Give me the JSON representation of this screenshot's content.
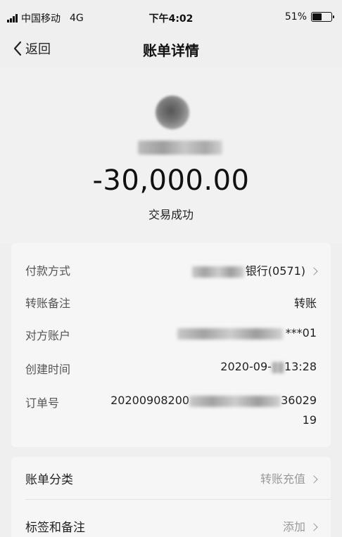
{
  "status_bar": {
    "carrier": "中国移动",
    "network": "4G",
    "time": "下午4:02",
    "battery_percent": "51%",
    "battery_level": 0.51
  },
  "nav": {
    "back_label": "返回",
    "title": "账单详情"
  },
  "summary": {
    "amount": "-30,000.00",
    "status": "交易成功"
  },
  "details": {
    "payment_method": {
      "label": "付款方式",
      "value": "银行(0571)"
    },
    "transfer_note": {
      "label": "转账备注",
      "value": "转账"
    },
    "counterparty": {
      "label": "对方账户",
      "value": "***01"
    },
    "created_time": {
      "label": "创建时间",
      "value_prefix": "2020-09-",
      "value_suffix": "13:28"
    },
    "order_no": {
      "label": "订单号",
      "value_prefix": "20200908200",
      "value_suffix": "36029",
      "value_line2": "19"
    }
  },
  "extra": {
    "category": {
      "label": "账单分类",
      "value": "转账充值"
    },
    "tags": {
      "label": "标签和备注",
      "value": "添加"
    }
  }
}
